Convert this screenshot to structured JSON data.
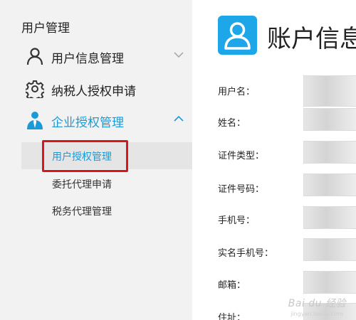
{
  "sidebar": {
    "title": "用户管理",
    "menu": [
      {
        "label": "用户信息管理",
        "icon": "user-icon",
        "expanded": false
      },
      {
        "label": "纳税人授权申请",
        "icon": "gear-icon"
      },
      {
        "label": "企业授权管理",
        "icon": "business-person-icon",
        "expanded": true
      }
    ],
    "submenu": [
      {
        "label": "用户授权管理",
        "selected": true
      },
      {
        "label": "委托代理申请",
        "selected": false
      },
      {
        "label": "税务代理管理",
        "selected": false
      }
    ]
  },
  "content": {
    "title": "账户信息",
    "header_icon": "user-icon",
    "fields": [
      {
        "label": "用户名："
      },
      {
        "label": "姓名："
      },
      {
        "label": "证件类型："
      },
      {
        "label": "证件号码："
      },
      {
        "label": "手机号："
      },
      {
        "label": "实名手机号："
      },
      {
        "label": "邮箱："
      },
      {
        "label": "住址："
      }
    ]
  },
  "watermark": {
    "text": "Bai du 经验",
    "sub": "jingyan.baidu.com"
  },
  "colors": {
    "accent": "#1a9bd8",
    "header_icon_bg": "#1ea7e8",
    "highlight": "#d9161c",
    "sidebar_bg": "#f2f2f2"
  }
}
